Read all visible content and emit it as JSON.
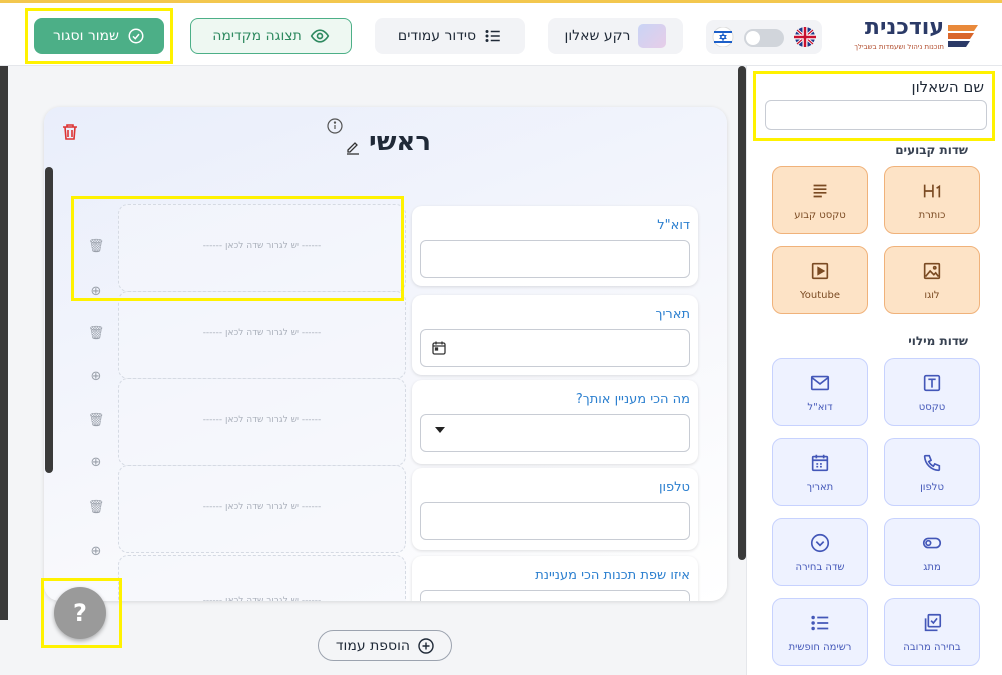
{
  "header": {
    "logo_title": "עודכנית",
    "logo_subtitle": "תוכנות ניהול ושעמדות בשבילך",
    "save_close_label": "שמור וסגור",
    "preview_label": "תצוגה מקדימה",
    "page_order_label": "סידור עמודים",
    "background_label": "רקע שאלון",
    "colors": {
      "save": "#4caf87",
      "accent": "#f3c74e"
    }
  },
  "canvas": {
    "page_title": "ראשי",
    "drop_placeholder": "------  יש לגרור שדה לכאן  ------",
    "fields": [
      {
        "label": "דוא\"ל",
        "type": "email"
      },
      {
        "label": "תאריך",
        "type": "date"
      },
      {
        "label": "מה הכי מעניין אותך?",
        "type": "select"
      },
      {
        "label": "טלפון",
        "type": "phone"
      },
      {
        "label": "איזו שפת תכנות הכי מעניינת",
        "type": "text"
      }
    ],
    "add_page_label": "הוספת עמוד",
    "help_label": "?"
  },
  "panel": {
    "form_name_label": "שם השאלון",
    "form_name_value": "",
    "fixed_fields_title": "שדות קבועים",
    "fixed_fields": [
      {
        "label": "כותרת",
        "icon": "heading-icon"
      },
      {
        "label": "טקסט קבוע",
        "icon": "text-lines-icon"
      },
      {
        "label": "לוגו",
        "icon": "image-icon"
      },
      {
        "label": "Youtube",
        "icon": "play-icon"
      }
    ],
    "fill_fields_title": "שדות מילוי",
    "fill_fields": [
      {
        "label": "טקסט",
        "icon": "text-box-icon"
      },
      {
        "label": "דוא\"ל",
        "icon": "envelope-icon"
      },
      {
        "label": "טלפון",
        "icon": "phone-icon"
      },
      {
        "label": "תאריך",
        "icon": "calendar-icon"
      },
      {
        "label": "מתג",
        "icon": "toggle-icon"
      },
      {
        "label": "שדה בחירה",
        "icon": "chevron-circle-icon"
      },
      {
        "label": "בחירה מרובה",
        "icon": "multi-check-icon"
      },
      {
        "label": "רשימה חופשית",
        "icon": "list-icon"
      }
    ]
  }
}
